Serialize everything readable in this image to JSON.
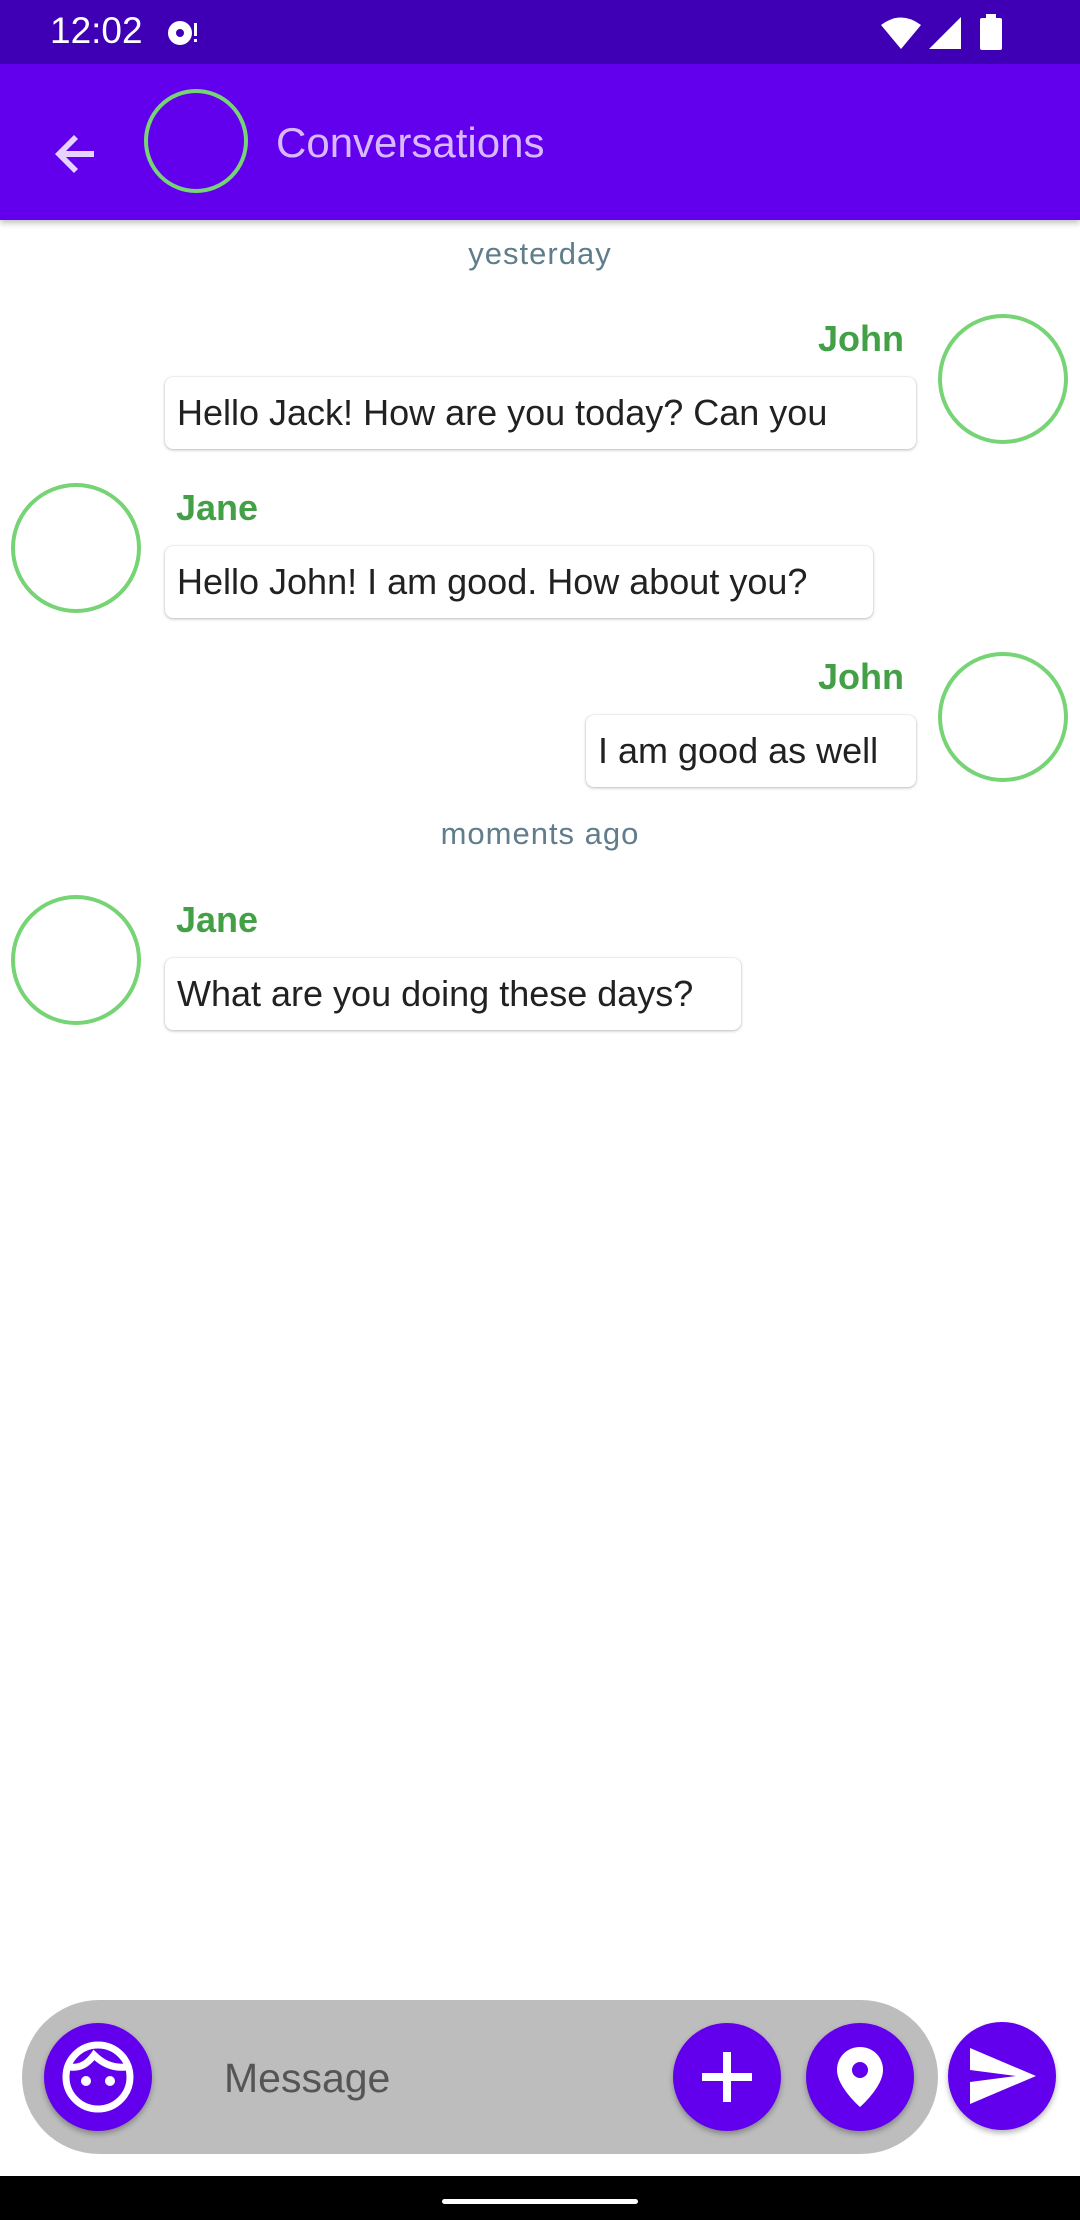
{
  "status_bar": {
    "time": "12:02",
    "icons": [
      "media-icon",
      "wifi-icon",
      "signal-icon",
      "battery-icon"
    ]
  },
  "app_bar": {
    "title": "Conversations",
    "back_icon": "arrow-back-icon",
    "background": "#6200ee"
  },
  "colors": {
    "primary": "#6200ee",
    "status_bar": "#3f00b5",
    "sender_name": "#43a047",
    "avatar_ring": "#76d475",
    "timestamp": "#607d8b",
    "composer": "#bdbdbd"
  },
  "messages": {
    "day1": "yesterday",
    "m1": {
      "sender": "John",
      "text": "Hello Jack! How are you today? Can you"
    },
    "m2": {
      "sender": "Jane",
      "text": "Hello John! I am good. How about you?"
    },
    "m3": {
      "sender": "John",
      "text": "I am good as well"
    },
    "day2": "moments ago",
    "m4": {
      "sender": "Jane",
      "text": "What are you doing these days?"
    }
  },
  "composer": {
    "placeholder": "Message",
    "value": "",
    "icons": [
      "face-icon",
      "plus-icon",
      "location-pin-icon",
      "send-icon"
    ]
  }
}
